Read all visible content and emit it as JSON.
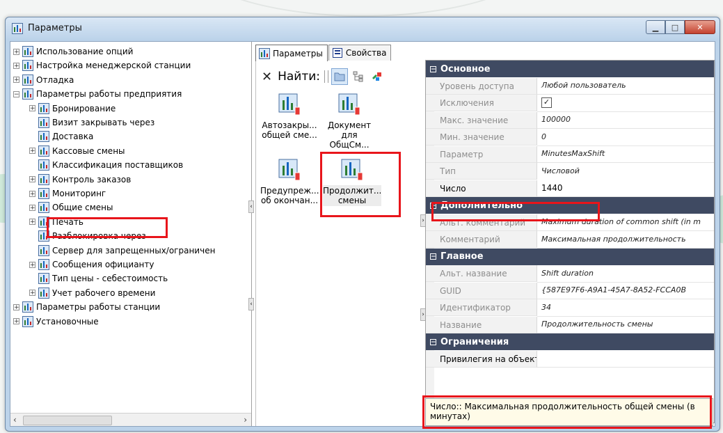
{
  "window": {
    "title": "Параметры",
    "icon": "parameters-app-icon"
  },
  "tree": {
    "items": [
      {
        "label": "Использование опций",
        "level": 0,
        "expander": "+"
      },
      {
        "label": "Настройка менеджерской станции",
        "level": 0,
        "expander": "+"
      },
      {
        "label": "Отладка",
        "level": 0,
        "expander": "+"
      },
      {
        "label": "Параметры работы предприятия",
        "level": 0,
        "expander": "−"
      },
      {
        "label": "Бронирование",
        "level": 1,
        "expander": "+"
      },
      {
        "label": "Визит закрывать через",
        "level": 1,
        "expander": ""
      },
      {
        "label": "Доставка",
        "level": 1,
        "expander": ""
      },
      {
        "label": "Кассовые смены",
        "level": 1,
        "expander": "+"
      },
      {
        "label": "Классификация поставщиков",
        "level": 1,
        "expander": ""
      },
      {
        "label": "Контроль заказов",
        "level": 1,
        "expander": "+"
      },
      {
        "label": "Мониторинг",
        "level": 1,
        "expander": "+"
      },
      {
        "label": "Общие смены",
        "level": 1,
        "expander": "+"
      },
      {
        "label": "Печать",
        "level": 1,
        "expander": "+"
      },
      {
        "label": "Разблокировка через",
        "level": 1,
        "expander": ""
      },
      {
        "label": "Сервер для запрещенных/ограничен",
        "level": 1,
        "expander": ""
      },
      {
        "label": "Сообщения официанту",
        "level": 1,
        "expander": "+"
      },
      {
        "label": "Тип цены - себестоимость",
        "level": 1,
        "expander": ""
      },
      {
        "label": "Учет рабочего времени",
        "level": 1,
        "expander": "+"
      },
      {
        "label": "Параметры работы станции",
        "level": 0,
        "expander": "+"
      },
      {
        "label": "Установочные",
        "level": 0,
        "expander": "+"
      }
    ],
    "highlighted": "Общие смены"
  },
  "tabs": [
    {
      "label": "Параметры",
      "active": true
    },
    {
      "label": "Свойства",
      "active": false
    }
  ],
  "toolbar": {
    "close_glyph": "✕",
    "find_label": "Найти:"
  },
  "items": [
    {
      "line1": "Автозакры...",
      "line2": "общей сме..."
    },
    {
      "line1": "Документ",
      "line2": "для ОбщСм..."
    },
    {
      "line1": "Предупреж...",
      "line2": "об окончан..."
    },
    {
      "line1": "Продолжит...",
      "line2": "смены"
    }
  ],
  "grid": {
    "categories": {
      "main": "Основное",
      "additional": "Дополнительно",
      "general": "Главное",
      "limits": "Ограничения"
    },
    "main": [
      {
        "name": "Уровень доступа",
        "value": "Любой пользователь"
      },
      {
        "name": "Исключения",
        "value": "☑"
      },
      {
        "name": "Макс. значение",
        "value": "100000"
      },
      {
        "name": "Мин. значение",
        "value": "0"
      },
      {
        "name": "Параметр",
        "value": "MinutesMaxShift"
      },
      {
        "name": "Тип",
        "value": "Числовой"
      },
      {
        "name": "Число",
        "value": "1440"
      }
    ],
    "additional": [
      {
        "name": "Альт. комментарий",
        "value": "Maximum duration of common shift (in m"
      },
      {
        "name": "Комментарий",
        "value": "Максимальная продолжительность"
      }
    ],
    "general": [
      {
        "name": "Альт. название",
        "value": "Shift duration"
      },
      {
        "name": "GUID",
        "value": "{587E97F6-A9A1-45A7-8A52-FCCA0B"
      },
      {
        "name": "Идентификатор",
        "value": "34"
      },
      {
        "name": "Название",
        "value": "Продолжительность смены"
      }
    ],
    "limits": [
      {
        "name": "Привилегия на объект",
        "value": ""
      }
    ]
  },
  "description": "Число:: Максимальная продолжительность общей смены (в минутах)",
  "colors": {
    "highlight": "#e8151b",
    "category_bg": "#3f4a62",
    "desc_bg": "#fffbe8"
  }
}
